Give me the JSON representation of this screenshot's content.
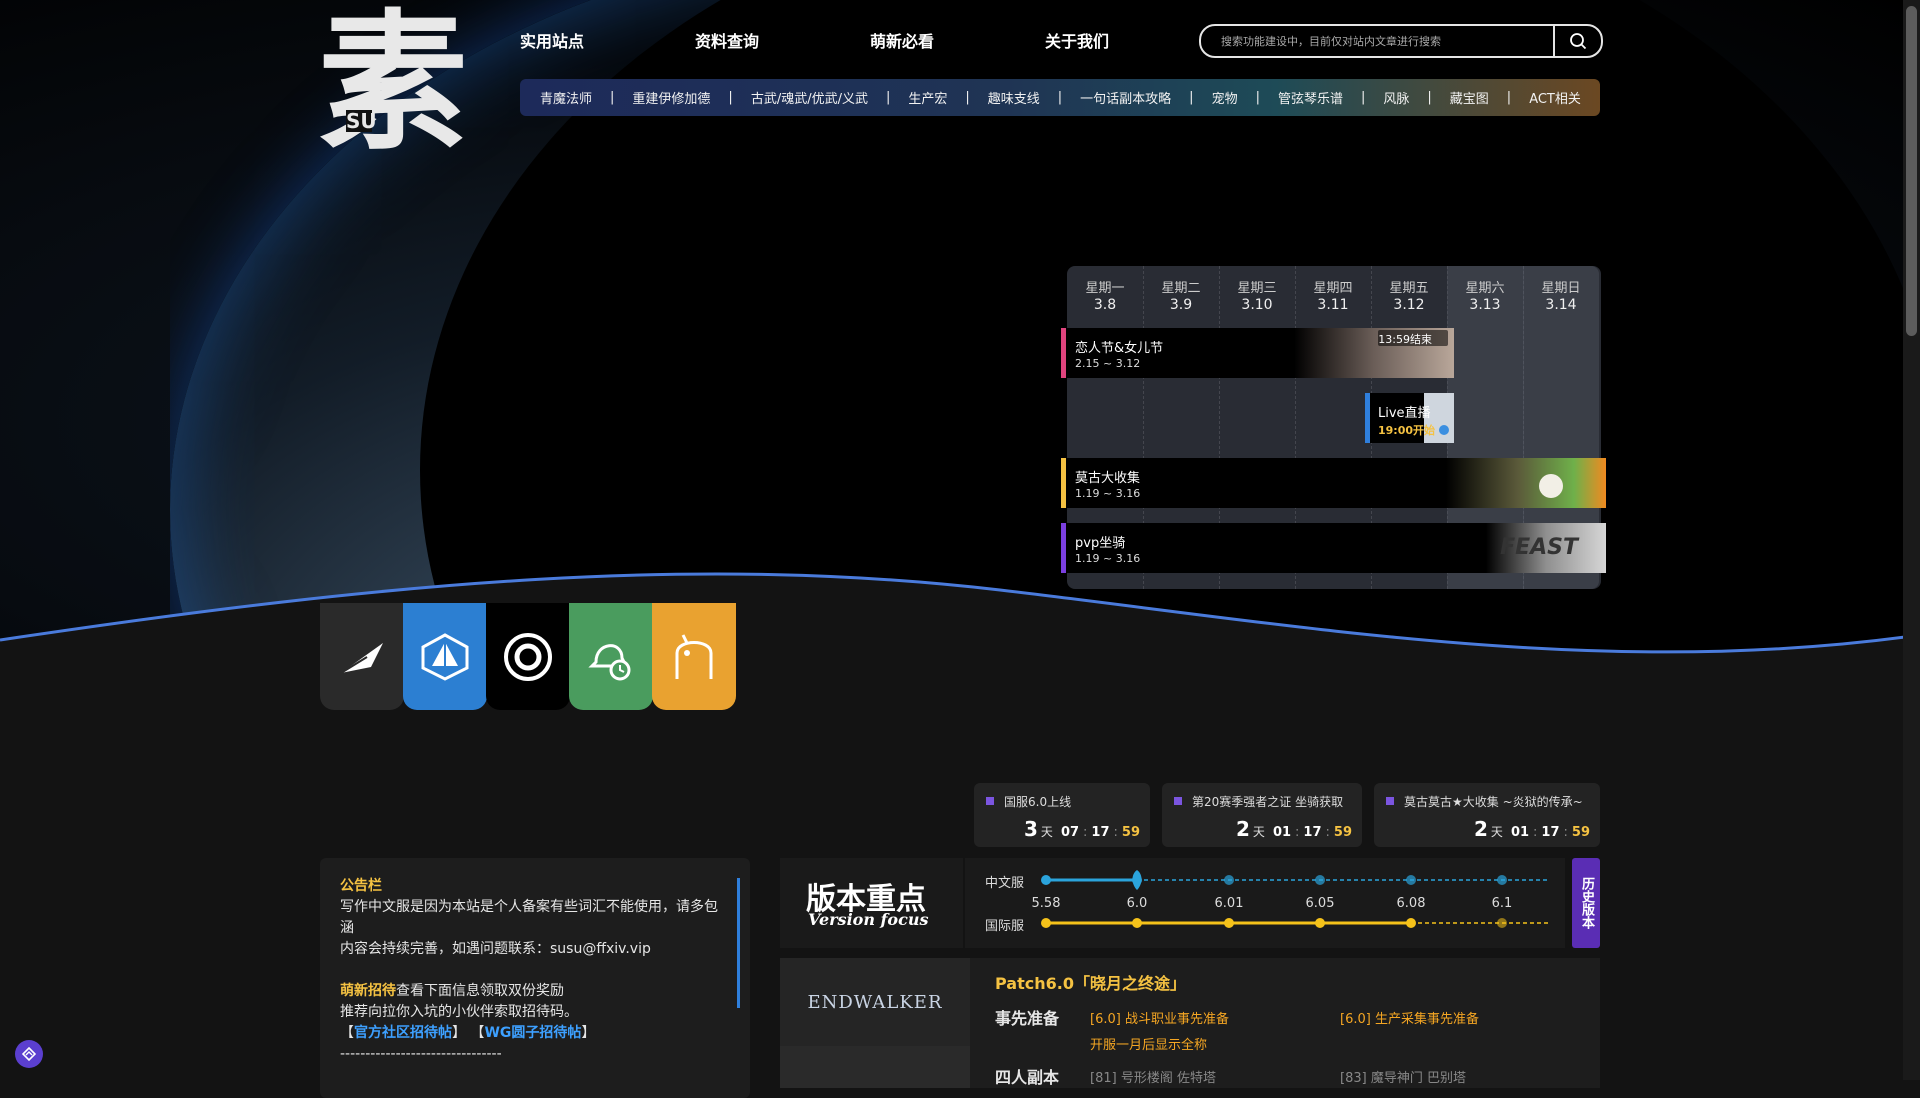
{
  "logo": {
    "main": "素",
    "sub": "SU"
  },
  "topnav": [
    "实用站点",
    "资料查询",
    "萌新必看",
    "关于我们"
  ],
  "search": {
    "placeholder": "搜索功能建设中，目前仅对站内文章进行搜索"
  },
  "subnav": [
    "青魔法师",
    "重建伊修加德",
    "古武/魂武/优武/义武",
    "生产宏",
    "趣味支线",
    "一句话副本攻略",
    "宠物",
    "管弦琴乐谱",
    "风脉",
    "藏宝图",
    "ACT相关"
  ],
  "calendar": {
    "days": [
      {
        "name": "星期一",
        "date": "3.8"
      },
      {
        "name": "星期二",
        "date": "3.9"
      },
      {
        "name": "星期三",
        "date": "3.10"
      },
      {
        "name": "星期四",
        "date": "3.11"
      },
      {
        "name": "星期五",
        "date": "3.12"
      },
      {
        "name": "星期六",
        "date": "3.13"
      },
      {
        "name": "星期日",
        "date": "3.14"
      }
    ],
    "events": [
      {
        "name": "恋人节&女儿节",
        "dates": "2.15 ~ 3.12",
        "tag": "13:59结束",
        "color": "#e0447e"
      },
      {
        "name": "Live直播",
        "dates": "19:00开始",
        "color": "#2f7fdc"
      },
      {
        "name": "莫古大收集",
        "dates": "1.19 ~ 3.16",
        "color": "#f5c242"
      },
      {
        "name": "pvp坐骑",
        "dates": "1.19 ~ 3.16",
        "art": "FEAST",
        "color": "#7b3fe0"
      }
    ]
  },
  "icon_tiles": [
    {
      "icon": "feather-icon",
      "color": "#2a2a2a"
    },
    {
      "icon": "crystal-icon",
      "color": "#2c7fd2"
    },
    {
      "icon": "ring-icon",
      "color": "#000000"
    },
    {
      "icon": "bell-clock-icon",
      "color": "#4a9c5e"
    },
    {
      "icon": "ghost-icon",
      "color": "#e9a230"
    }
  ],
  "countdowns": [
    {
      "label": "国服6.0上线",
      "days": "3",
      "unit": "天",
      "h": "07",
      "m": "17",
      "s": "59"
    },
    {
      "label": "第20赛季强者之证 坐骑获取",
      "days": "2",
      "unit": "天",
      "h": "01",
      "m": "17",
      "s": "59"
    },
    {
      "label": "莫古莫古★大收集 ~炎狱的传承~",
      "days": "2",
      "unit": "天",
      "h": "01",
      "m": "17",
      "s": "59"
    }
  ],
  "notice": {
    "title": "公告栏",
    "line1": "写作中文服是因为本站是个人备案有些词汇不能使用，请多包涵",
    "line2": "内容会持续完善，如遇问题联系：susu@ffxiv.vip",
    "invite_title": "萌新招待",
    "invite_text": "查看下面信息领取双份奖励",
    "line3": "推荐向拉你入坑的小伙伴索取招待码。",
    "bracket_l": "【",
    "bracket_r": "】",
    "link1": "官方社区招待帖",
    "link2": "WG圆子招待帖",
    "divider": "--------------------------------"
  },
  "version": {
    "title_cn": "版本重点",
    "title_en": "Version focus",
    "cn_label": "中文服",
    "intl_label": "国际服",
    "versions": [
      "5.58",
      "6.0",
      "6.01",
      "6.05",
      "6.08",
      "6.1"
    ],
    "history_btn": "历史版本",
    "colors": {
      "cn": "#2ba4dc",
      "intl": "#f5c21a"
    }
  },
  "patch": {
    "logo": "ENDWALKER",
    "title": "Patch6.0「晓月之终途」",
    "row1_label": "事先准备",
    "link1": "[6.0] 战斗职业事先准备",
    "link2": "[6.0] 生产采集事先准备",
    "link3": "开服一月后显示全称",
    "row2_label": "四人副本",
    "link4": "[81] 号形楼阁 佐特塔",
    "link5": "[83] 魔导神门 巴别塔"
  }
}
